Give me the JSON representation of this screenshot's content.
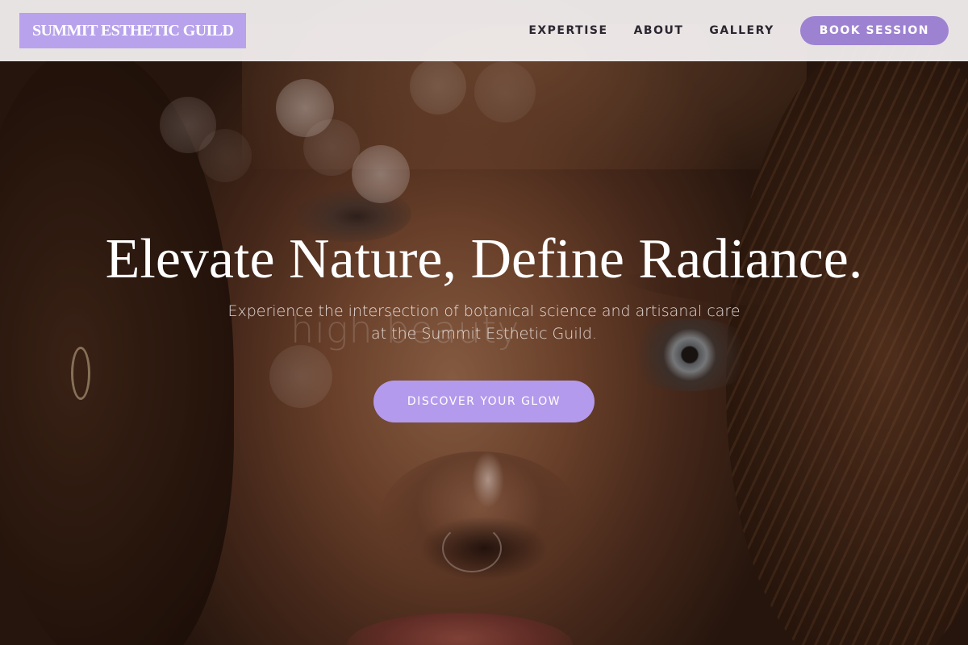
{
  "header": {
    "brand": "SUMMIT ESTHETIC GUILD",
    "nav": [
      {
        "label": "EXPERTISE"
      },
      {
        "label": "ABOUT"
      },
      {
        "label": "GALLERY"
      }
    ],
    "book_label": "BOOK SESSION"
  },
  "hero": {
    "title": "Elevate Nature, Define Radiance.",
    "subtitle_line1": "Experience the intersection of botanical science and artisanal care",
    "subtitle_line2": "at the Summit Esthetic Guild.",
    "cta_label": "DISCOVER YOUR GLOW",
    "ghost_text": "high beauty"
  },
  "colors": {
    "accent": "#b8a2ec",
    "button": "#9e82d2",
    "cta": "#b49aec",
    "header_bg": "#f0ecec",
    "nav_text": "#2b2630"
  },
  "icons": []
}
